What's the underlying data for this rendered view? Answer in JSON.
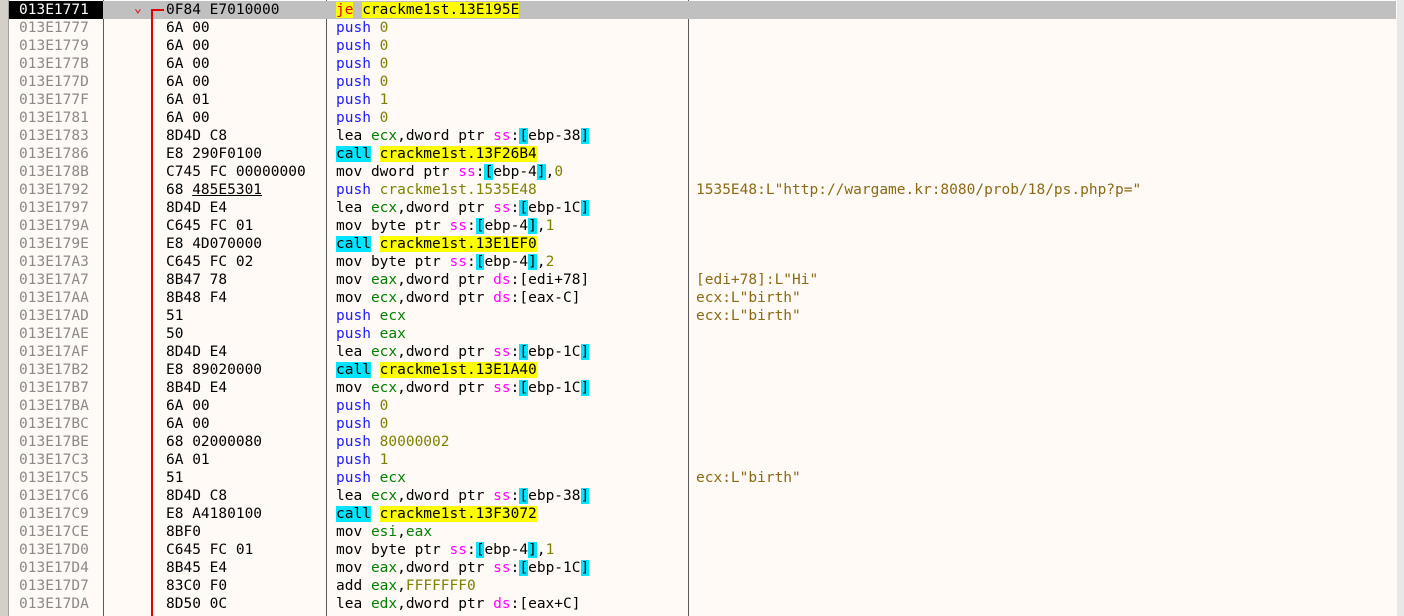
{
  "rows": [
    {
      "addr": "013E1771",
      "bytes": "0F84 E7010000",
      "mn": "je",
      "kind": "je",
      "ops": [
        {
          "t": "crackme1st.13E195E",
          "c": "tgt"
        }
      ],
      "current": true
    },
    {
      "addr": "013E1777",
      "bytes": "6A 00",
      "mn": "push",
      "kind": "push",
      "ops": [
        {
          "t": "0",
          "c": "imm"
        }
      ]
    },
    {
      "addr": "013E1779",
      "bytes": "6A 00",
      "mn": "push",
      "kind": "push",
      "ops": [
        {
          "t": "0",
          "c": "imm"
        }
      ]
    },
    {
      "addr": "013E177B",
      "bytes": "6A 00",
      "mn": "push",
      "kind": "push",
      "ops": [
        {
          "t": "0",
          "c": "imm"
        }
      ]
    },
    {
      "addr": "013E177D",
      "bytes": "6A 00",
      "mn": "push",
      "kind": "push",
      "ops": [
        {
          "t": "0",
          "c": "imm"
        }
      ]
    },
    {
      "addr": "013E177F",
      "bytes": "6A 01",
      "mn": "push",
      "kind": "push",
      "ops": [
        {
          "t": "1",
          "c": "imm"
        }
      ]
    },
    {
      "addr": "013E1781",
      "bytes": "6A 00",
      "mn": "push",
      "kind": "push",
      "ops": [
        {
          "t": "0",
          "c": "imm"
        }
      ]
    },
    {
      "addr": "013E1783",
      "bytes": "8D4D C8",
      "mn": "lea",
      "kind": "plain",
      "ops": [
        {
          "t": "ecx",
          "c": "reg"
        },
        {
          "t": ",dword ptr "
        },
        {
          "t": "ss",
          "c": "seg"
        },
        {
          "t": ":"
        },
        {
          "t": "[",
          "c": "br"
        },
        {
          "t": "ebp-38",
          "c": "pl"
        },
        {
          "t": "]",
          "c": "br"
        }
      ]
    },
    {
      "addr": "013E1786",
      "bytes": "E8 290F0100",
      "mn": "call",
      "kind": "call",
      "ops": [
        {
          "t": "crackme1st.13F26B4",
          "c": "tgt"
        }
      ]
    },
    {
      "addr": "013E178B",
      "bytes": "C745 FC 00000000",
      "mn": "mov",
      "kind": "plain",
      "ops": [
        {
          "t": "dword ptr "
        },
        {
          "t": "ss",
          "c": "seg"
        },
        {
          "t": ":"
        },
        {
          "t": "[",
          "c": "br"
        },
        {
          "t": "ebp-4",
          "c": "pl"
        },
        {
          "t": "]",
          "c": "br"
        },
        {
          "t": ","
        },
        {
          "t": "0",
          "c": "imm"
        }
      ]
    },
    {
      "addr": "013E1792",
      "bytes": "68 485E5301",
      "bytesLink": true,
      "mn": "push",
      "kind": "push",
      "ops": [
        {
          "t": "crackme1st.1535E48",
          "c": "imm"
        }
      ],
      "comment": "1535E48:L\"http://wargame.kr:8080/prob/18/ps.php?p=\""
    },
    {
      "addr": "013E1797",
      "bytes": "8D4D E4",
      "mn": "lea",
      "kind": "plain",
      "ops": [
        {
          "t": "ecx",
          "c": "reg"
        },
        {
          "t": ",dword ptr "
        },
        {
          "t": "ss",
          "c": "seg"
        },
        {
          "t": ":"
        },
        {
          "t": "[",
          "c": "br"
        },
        {
          "t": "ebp-1C",
          "c": "pl"
        },
        {
          "t": "]",
          "c": "br"
        }
      ]
    },
    {
      "addr": "013E179A",
      "bytes": "C645 FC 01",
      "mn": "mov",
      "kind": "plain",
      "ops": [
        {
          "t": "byte ptr "
        },
        {
          "t": "ss",
          "c": "seg"
        },
        {
          "t": ":"
        },
        {
          "t": "[",
          "c": "br"
        },
        {
          "t": "ebp-4",
          "c": "pl"
        },
        {
          "t": "]",
          "c": "br"
        },
        {
          "t": ","
        },
        {
          "t": "1",
          "c": "imm"
        }
      ]
    },
    {
      "addr": "013E179E",
      "bytes": "E8 4D070000",
      "mn": "call",
      "kind": "call",
      "ops": [
        {
          "t": "crackme1st.13E1EF0",
          "c": "tgt"
        }
      ]
    },
    {
      "addr": "013E17A3",
      "bytes": "C645 FC 02",
      "mn": "mov",
      "kind": "plain",
      "ops": [
        {
          "t": "byte ptr "
        },
        {
          "t": "ss",
          "c": "seg"
        },
        {
          "t": ":"
        },
        {
          "t": "[",
          "c": "br"
        },
        {
          "t": "ebp-4",
          "c": "pl"
        },
        {
          "t": "]",
          "c": "br"
        },
        {
          "t": ","
        },
        {
          "t": "2",
          "c": "imm"
        }
      ]
    },
    {
      "addr": "013E17A7",
      "bytes": "8B47 78",
      "mn": "mov",
      "kind": "plain",
      "ops": [
        {
          "t": "eax",
          "c": "reg"
        },
        {
          "t": ",dword ptr "
        },
        {
          "t": "ds",
          "c": "seg"
        },
        {
          "t": ":[edi+78]"
        }
      ],
      "comment": "[edi+78]:L\"Hi\""
    },
    {
      "addr": "013E17AA",
      "bytes": "8B48 F4",
      "mn": "mov",
      "kind": "plain",
      "ops": [
        {
          "t": "ecx",
          "c": "reg"
        },
        {
          "t": ",dword ptr "
        },
        {
          "t": "ds",
          "c": "seg"
        },
        {
          "t": ":[eax-C]"
        }
      ],
      "comment": "ecx:L\"birth\""
    },
    {
      "addr": "013E17AD",
      "bytes": "51",
      "mn": "push",
      "kind": "push",
      "ops": [
        {
          "t": "ecx",
          "c": "reg"
        }
      ],
      "comment": "ecx:L\"birth\""
    },
    {
      "addr": "013E17AE",
      "bytes": "50",
      "mn": "push",
      "kind": "push",
      "ops": [
        {
          "t": "eax",
          "c": "reg"
        }
      ]
    },
    {
      "addr": "013E17AF",
      "bytes": "8D4D E4",
      "mn": "lea",
      "kind": "plain",
      "ops": [
        {
          "t": "ecx",
          "c": "reg"
        },
        {
          "t": ",dword ptr "
        },
        {
          "t": "ss",
          "c": "seg"
        },
        {
          "t": ":"
        },
        {
          "t": "[",
          "c": "br"
        },
        {
          "t": "ebp-1C",
          "c": "pl"
        },
        {
          "t": "]",
          "c": "br"
        }
      ]
    },
    {
      "addr": "013E17B2",
      "bytes": "E8 89020000",
      "mn": "call",
      "kind": "call",
      "ops": [
        {
          "t": "crackme1st.13E1A40",
          "c": "tgt"
        }
      ]
    },
    {
      "addr": "013E17B7",
      "bytes": "8B4D E4",
      "mn": "mov",
      "kind": "plain",
      "ops": [
        {
          "t": "ecx",
          "c": "reg"
        },
        {
          "t": ",dword ptr "
        },
        {
          "t": "ss",
          "c": "seg"
        },
        {
          "t": ":"
        },
        {
          "t": "[",
          "c": "br"
        },
        {
          "t": "ebp-1C",
          "c": "pl"
        },
        {
          "t": "]",
          "c": "br"
        }
      ]
    },
    {
      "addr": "013E17BA",
      "bytes": "6A 00",
      "mn": "push",
      "kind": "push",
      "ops": [
        {
          "t": "0",
          "c": "imm"
        }
      ]
    },
    {
      "addr": "013E17BC",
      "bytes": "6A 00",
      "mn": "push",
      "kind": "push",
      "ops": [
        {
          "t": "0",
          "c": "imm"
        }
      ]
    },
    {
      "addr": "013E17BE",
      "bytes": "68 02000080",
      "mn": "push",
      "kind": "push",
      "ops": [
        {
          "t": "80000002",
          "c": "imm"
        }
      ]
    },
    {
      "addr": "013E17C3",
      "bytes": "6A 01",
      "mn": "push",
      "kind": "push",
      "ops": [
        {
          "t": "1",
          "c": "imm"
        }
      ]
    },
    {
      "addr": "013E17C5",
      "bytes": "51",
      "mn": "push",
      "kind": "push",
      "ops": [
        {
          "t": "ecx",
          "c": "reg"
        }
      ],
      "comment": "ecx:L\"birth\""
    },
    {
      "addr": "013E17C6",
      "bytes": "8D4D C8",
      "mn": "lea",
      "kind": "plain",
      "ops": [
        {
          "t": "ecx",
          "c": "reg"
        },
        {
          "t": ",dword ptr "
        },
        {
          "t": "ss",
          "c": "seg"
        },
        {
          "t": ":"
        },
        {
          "t": "[",
          "c": "br"
        },
        {
          "t": "ebp-38",
          "c": "pl"
        },
        {
          "t": "]",
          "c": "br"
        }
      ]
    },
    {
      "addr": "013E17C9",
      "bytes": "E8 A4180100",
      "mn": "call",
      "kind": "call",
      "ops": [
        {
          "t": "crackme1st.13F3072",
          "c": "tgt"
        }
      ]
    },
    {
      "addr": "013E17CE",
      "bytes": "8BF0",
      "mn": "mov",
      "kind": "plain",
      "ops": [
        {
          "t": "esi",
          "c": "reg"
        },
        {
          "t": ","
        },
        {
          "t": "eax",
          "c": "reg"
        }
      ]
    },
    {
      "addr": "013E17D0",
      "bytes": "C645 FC 01",
      "mn": "mov",
      "kind": "plain",
      "ops": [
        {
          "t": "byte ptr "
        },
        {
          "t": "ss",
          "c": "seg"
        },
        {
          "t": ":"
        },
        {
          "t": "[",
          "c": "br"
        },
        {
          "t": "ebp-4",
          "c": "pl"
        },
        {
          "t": "]",
          "c": "br"
        },
        {
          "t": ","
        },
        {
          "t": "1",
          "c": "imm"
        }
      ]
    },
    {
      "addr": "013E17D4",
      "bytes": "8B45 E4",
      "mn": "mov",
      "kind": "plain",
      "ops": [
        {
          "t": "eax",
          "c": "reg"
        },
        {
          "t": ",dword ptr "
        },
        {
          "t": "ss",
          "c": "seg"
        },
        {
          "t": ":"
        },
        {
          "t": "[",
          "c": "br"
        },
        {
          "t": "ebp-1C",
          "c": "pl"
        },
        {
          "t": "]",
          "c": "br"
        }
      ]
    },
    {
      "addr": "013E17D7",
      "bytes": "83C0 F0",
      "mn": "add",
      "kind": "plain",
      "ops": [
        {
          "t": "eax",
          "c": "reg"
        },
        {
          "t": ","
        },
        {
          "t": "FFFFFFF0",
          "c": "imm"
        }
      ]
    },
    {
      "addr": "013E17DA",
      "bytes": "8D50 0C",
      "mn": "lea",
      "kind": "plain",
      "ops": [
        {
          "t": "edx",
          "c": "reg"
        },
        {
          "t": ",dword ptr "
        },
        {
          "t": "ds",
          "c": "seg"
        },
        {
          "t": ":[eax+C]"
        }
      ]
    }
  ],
  "colors": {
    "background": "#fffaf5",
    "current_row": "#c0c0c0",
    "jump_arrow": "#e00000",
    "call_highlight": "#00e5ff",
    "target_highlight": "#ffff00",
    "push_mnemonic": "#1a1aff",
    "register": "#008000",
    "segment": "#ff00ff",
    "immediate": "#808000",
    "comment": "#8b6914"
  },
  "icons": {
    "jump_marker": "chevron-down-icon"
  }
}
